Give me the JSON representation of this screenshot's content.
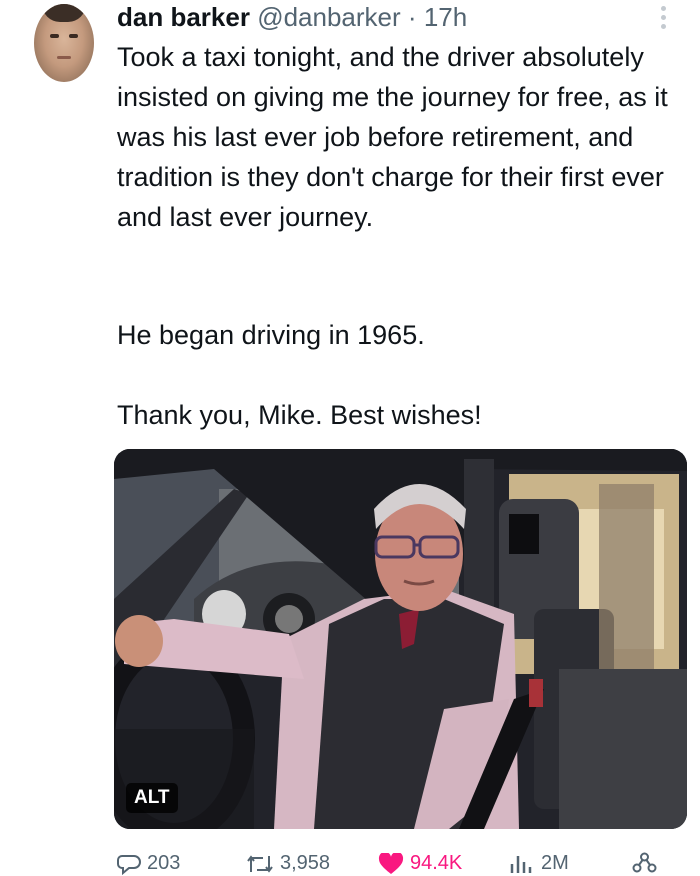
{
  "tweet": {
    "author_name": "dan barker",
    "handle": "@danbarker",
    "separator": "·",
    "time": "17h",
    "paragraphs": [
      "Took a taxi tonight, and the driver absolutely insisted on giving me the journey for free, as it was his last ever job before retirement, and tradition is they don't charge for their first ever and last ever journey.",
      "He began driving in 1965.",
      "Thank you, Mike. Best wishes!"
    ],
    "media": {
      "alt_badge": "ALT"
    },
    "actions": {
      "replies": "203",
      "reposts": "3,958",
      "likes": "94.4K",
      "views": "2M"
    }
  },
  "colors": {
    "like": "#f91880",
    "secondary": "#536471",
    "text": "#0f1419"
  },
  "icons": [
    "more-icon",
    "reply-icon",
    "repost-icon",
    "heart-icon",
    "views-icon",
    "share-icon"
  ]
}
